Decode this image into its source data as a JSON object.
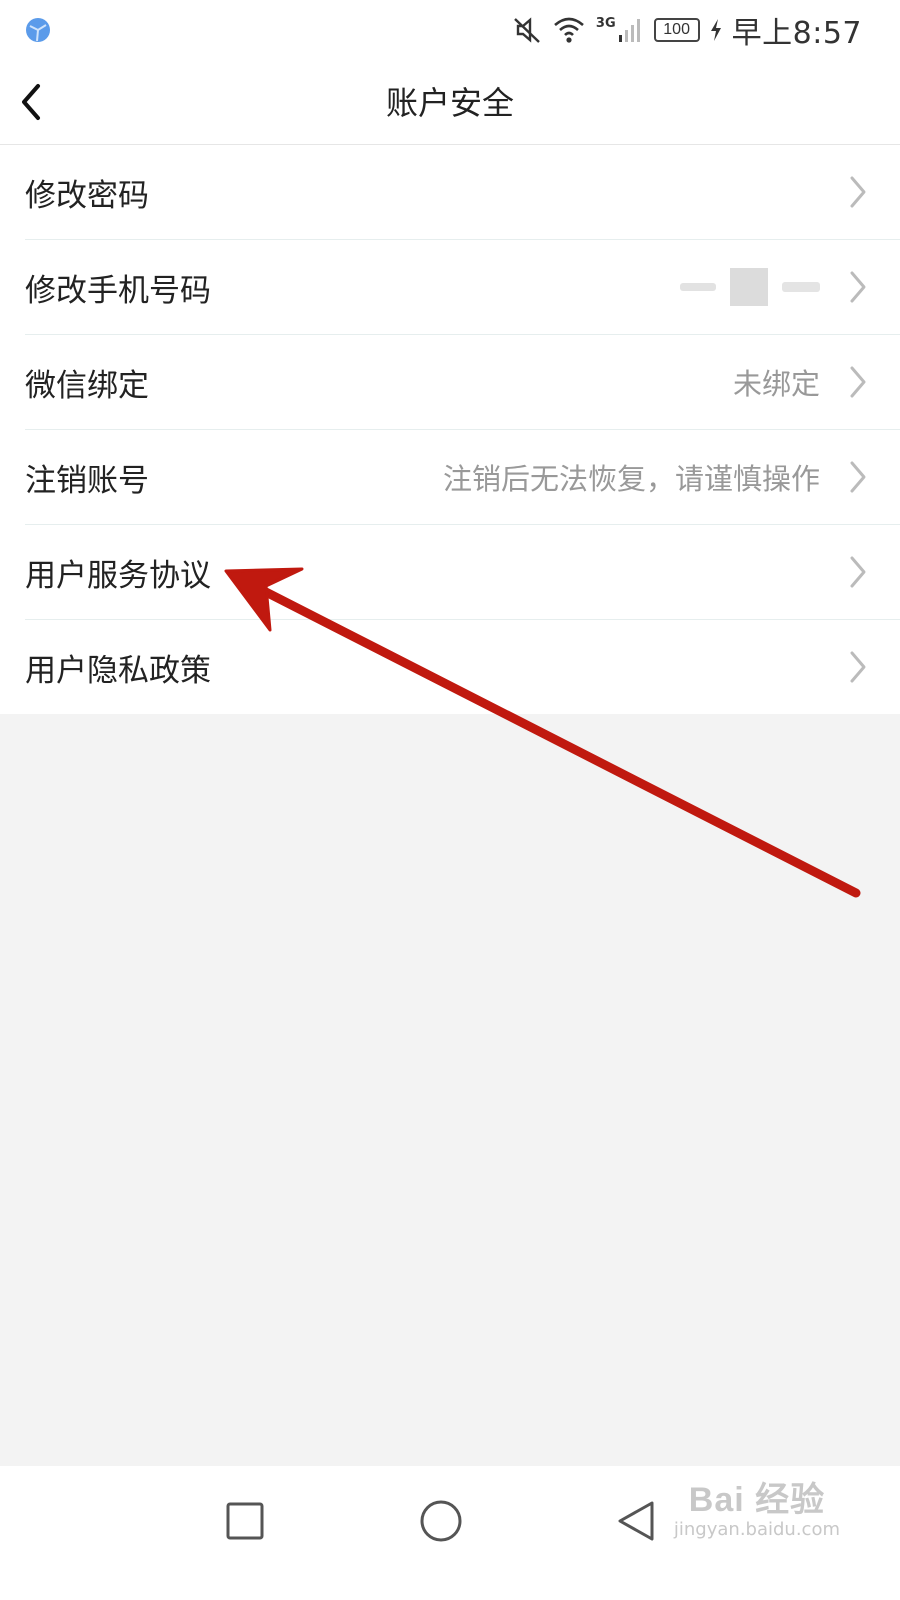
{
  "status_bar": {
    "network": "3G",
    "battery": "100",
    "time": "早上8:57"
  },
  "header": {
    "title": "账户安全"
  },
  "menu": [
    {
      "label": "修改密码",
      "value": ""
    },
    {
      "label": "修改手机号码",
      "value": ""
    },
    {
      "label": "微信绑定",
      "value": "未绑定"
    },
    {
      "label": "注销账号",
      "value": "注销后无法恢复，请谨慎操作"
    },
    {
      "label": "用户服务协议",
      "value": ""
    },
    {
      "label": "用户隐私政策",
      "value": ""
    }
  ],
  "watermark": {
    "main": "Bai 经验",
    "sub": "jingyan.baidu.com"
  },
  "colors": {
    "annotation_arrow": "#c0190f",
    "background": "#f3f3f3",
    "list_background": "#ffffff",
    "muted_text": "#999999"
  }
}
